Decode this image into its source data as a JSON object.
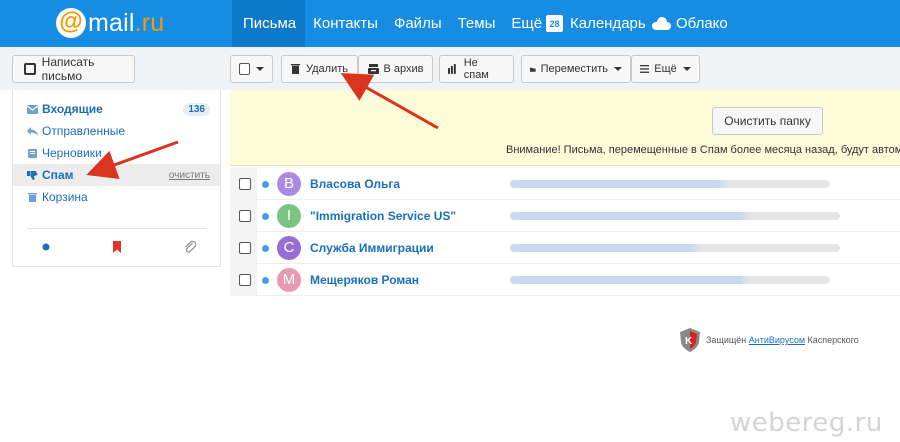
{
  "header": {
    "logo_at": "@",
    "logo_brand": "mail",
    "logo_tld": ".ru",
    "nav": [
      "Письма",
      "Контакты",
      "Файлы",
      "Темы",
      "Ещё"
    ],
    "calendar_day": "28",
    "calendar": "Календарь",
    "cloud": "Облако",
    "bg_color": "#168de2",
    "accent_color": "#f59a00"
  },
  "sidebar": {
    "compose": "Написать письмо",
    "folders": [
      {
        "label": "Входящие",
        "icon": "envelope-icon",
        "count": "136"
      },
      {
        "label": "Отправленные",
        "icon": "reply-icon"
      },
      {
        "label": "Черновики",
        "icon": "draft-icon"
      },
      {
        "label": "Спам",
        "icon": "thumb-down-icon",
        "action": "очистить"
      },
      {
        "label": "Корзина",
        "icon": "trash-icon"
      }
    ],
    "bottom_icons": [
      "unread-dot-icon",
      "flag-icon",
      "attachment-icon"
    ]
  },
  "toolbar": {
    "delete": "Удалить",
    "archive": "В архив",
    "not_spam": "Не спам",
    "move": "Переместить",
    "more": "Ещё"
  },
  "notice": {
    "clear_button": "Очистить папку",
    "text": "Внимание! Письма, перемещенные в Спам более месяца назад, будут автомати"
  },
  "messages": [
    {
      "avatar_letter": "В",
      "avatar_color": "#a98be0",
      "from": "Власова Ольга"
    },
    {
      "avatar_letter": "I",
      "avatar_color": "#7bc47f",
      "from": "\"Immigration Service US\""
    },
    {
      "avatar_letter": "С",
      "avatar_color": "#9b6bd6",
      "from": "Служба Иммиграции"
    },
    {
      "avatar_letter": "М",
      "avatar_color": "#e89ab3",
      "from": "Мещеряков Роман"
    }
  ],
  "footer": {
    "protected_prefix": "Защищён ",
    "antivirus_link": "АнтиВирусом",
    "protected_suffix": " Касперского",
    "watermark": "webereg.ru"
  }
}
